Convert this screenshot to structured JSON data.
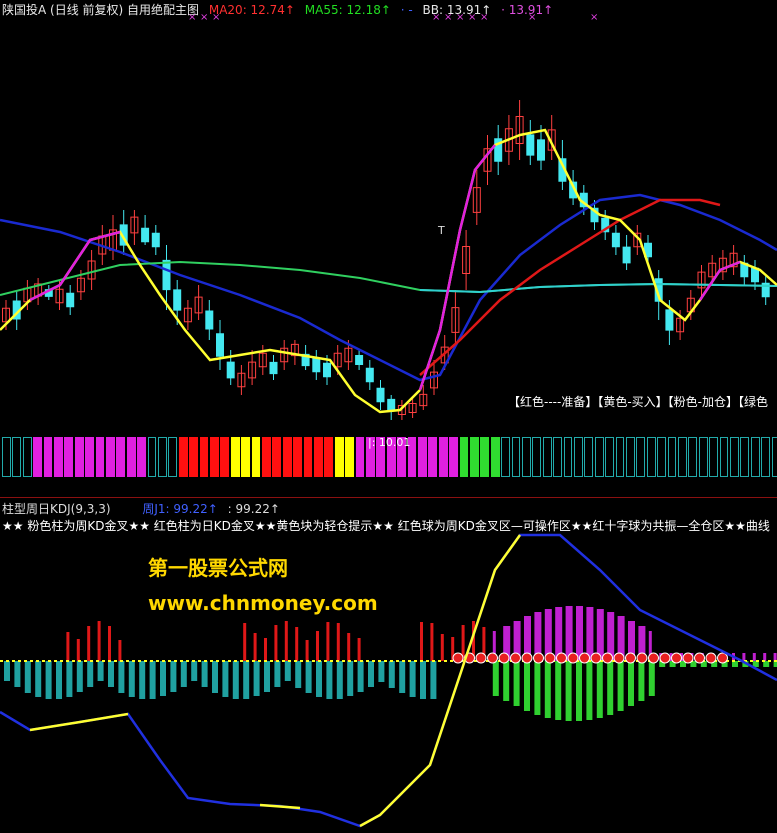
{
  "header": {
    "title": "陕国投A (日线 前复权) 自用绝配主图",
    "ma20_label": "MA20: 12.74↑",
    "ma55_label": "MA55: 12.18↑",
    "dash_label": "· -",
    "bb_label": "BB: 13.91↑",
    "extra_label": "· 13.91↑",
    "colors": {
      "title": "#e8e8e8",
      "ma20": "#ff3030",
      "ma55": "#22dd22",
      "bb": "#e8e8e8",
      "extra": "#e050e0"
    }
  },
  "main_legend": {
    "text": "【红色----准备】【黄色-买入】【粉色-加仓】【绿色"
  },
  "strip_label": "|: 10.01",
  "kdj": {
    "title": "柱型周日KDJ(9,3,3)",
    "value1": "周J1: 99.22↑",
    "value2": ": 99.22↑",
    "colors": {
      "title": "#dddddd",
      "value1": "#4060ff",
      "value2": "#dddddd"
    }
  },
  "marquee": {
    "text": "★★ 粉色柱为周KD金叉★★ 红色柱为日KD金叉★★黄色块为轻仓提示★★ 红色球为周KD金叉区—可操作区★★红十字球为共振—全仓区★★曲线"
  },
  "watermark": {
    "line1": "第一股票公式网",
    "line2": "www.chnmoney.com"
  },
  "strip_colors": [
    "#2aa",
    "#2aa",
    "#2aa",
    "#e020e0",
    "#e020e0",
    "#e020e0",
    "#e020e0",
    "#e020e0",
    "#e020e0",
    "#e020e0",
    "#e020e0",
    "#e020e0",
    "#e020e0",
    "#e020e0",
    "#2aa",
    "#2aa",
    "#2aa",
    "#ff1010",
    "#ff1010",
    "#ff1010",
    "#ff1010",
    "#ff1010",
    "#ffff00",
    "#ffff00",
    "#ffff00",
    "#ff1010",
    "#ff1010",
    "#ff1010",
    "#ff1010",
    "#ff1010",
    "#ff1010",
    "#ff1010",
    "#ffff00",
    "#ffff00",
    "#e020e0",
    "#e020e0",
    "#e020e0",
    "#e020e0",
    "#e020e0",
    "#e020e0",
    "#e020e0",
    "#e020e0",
    "#e020e0",
    "#e020e0",
    "#30dd30",
    "#30dd30",
    "#30dd30",
    "#30dd30",
    "#2aa",
    "#2aa",
    "#2aa",
    "#2aa",
    "#2aa",
    "#2aa",
    "#2aa",
    "#2aa",
    "#2aa",
    "#2aa",
    "#2aa",
    "#2aa",
    "#2aa",
    "#2aa",
    "#2aa",
    "#2aa",
    "#2aa",
    "#2aa",
    "#2aa",
    "#2aa",
    "#2aa",
    "#2aa",
    "#2aa",
    "#2aa",
    "#2aa",
    "#2aa",
    "#2aa"
  ]
}
